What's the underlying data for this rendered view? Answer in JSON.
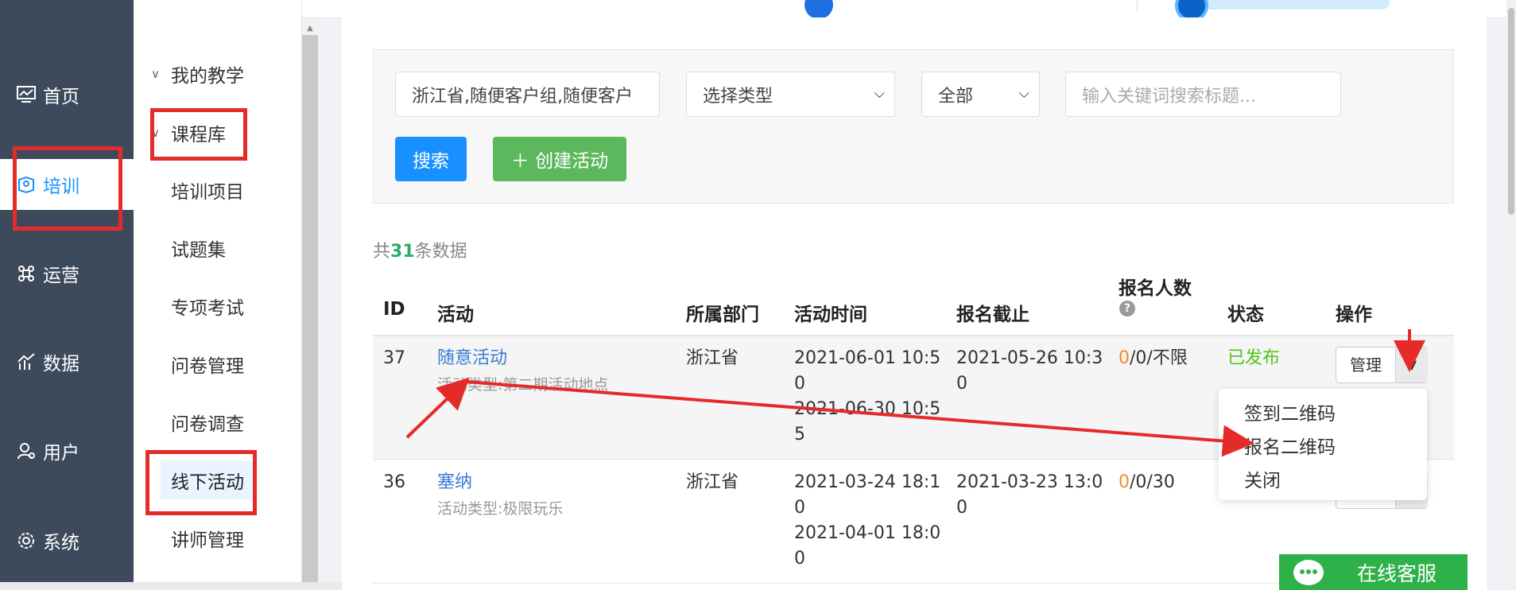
{
  "sidebar": {
    "items": [
      {
        "label": "首页",
        "icon": "dashboard-icon"
      },
      {
        "label": "培训",
        "icon": "training-icon"
      },
      {
        "label": "运营",
        "icon": "operation-icon"
      },
      {
        "label": "数据",
        "icon": "chart-icon"
      },
      {
        "label": "用户",
        "icon": "user-icon"
      },
      {
        "label": "系统",
        "icon": "gear-icon"
      }
    ],
    "active": "培训"
  },
  "submenu": {
    "group1": "我的教学",
    "group2": "课程库",
    "items": [
      "培训项目",
      "试题集",
      "专项考试",
      "问卷管理",
      "问卷调查",
      "线下活动",
      "讲师管理"
    ],
    "active": "线下活动"
  },
  "filters": {
    "department_value": "浙江省,随便客户组,随便客户",
    "type_select": "选择类型",
    "status_select": "全部",
    "keyword_placeholder": "输入关键词搜索标题..."
  },
  "buttons": {
    "search": "搜索",
    "create": "＋ 创建活动"
  },
  "summary": {
    "prefix": "共",
    "count": "31",
    "suffix": "条数据"
  },
  "table": {
    "headers": {
      "id": "ID",
      "activity": "活动",
      "dept": "所属部门",
      "time": "活动时间",
      "deadline": "报名截止",
      "signups": "报名人数",
      "status": "状态",
      "ops": "操作"
    },
    "rows": [
      {
        "id": "37",
        "title": "随意活动",
        "subtitle": "活动类型:第二期活动地点",
        "dept": "浙江省",
        "time": [
          "2021-06-01 10:5",
          "0",
          "2021-06-30 10:5",
          "5"
        ],
        "deadline": [
          "2021-05-26 10:3",
          "0"
        ],
        "signups_first": "0",
        "signups_rest": "/0/不限",
        "status": "已发布"
      },
      {
        "id": "36",
        "title": "塞纳",
        "subtitle": "活动类型:极限玩乐",
        "dept": "浙江省",
        "time": [
          "2021-03-24 18:1",
          "0",
          "2021-04-01 18:0",
          "0"
        ],
        "deadline": [
          "2021-03-23 13:0",
          "0"
        ],
        "signups_first": "0",
        "signups_rest": "/0/30",
        "status": ""
      }
    ],
    "manage_label": "管理"
  },
  "dropdown": {
    "items": [
      "签到二维码",
      "报名二维码",
      "关闭"
    ]
  },
  "chat": {
    "label": "在线客服"
  },
  "colors": {
    "sidebar": "#3d4a5c",
    "accent": "#1890ff",
    "green": "#5cb85c",
    "annotation_red": "#e52a2a"
  }
}
